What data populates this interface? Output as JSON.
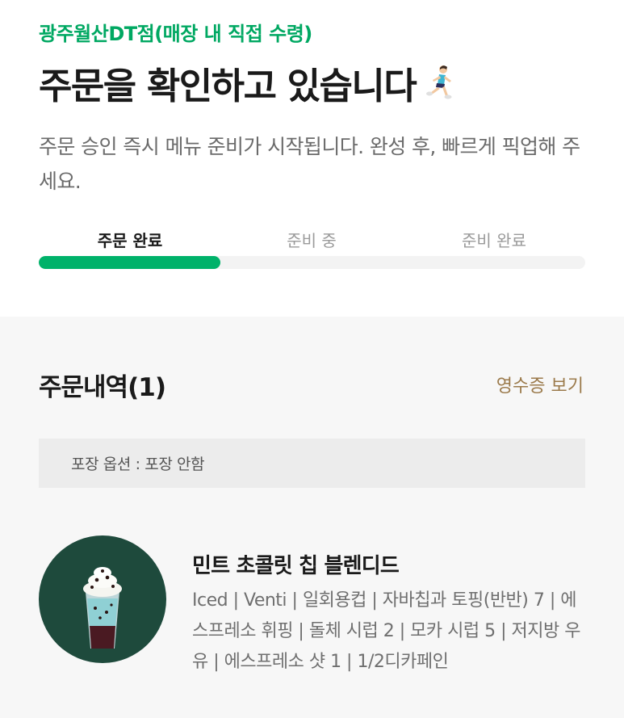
{
  "colors": {
    "brand_green": "#00a862",
    "progress_fill": "#00b26a",
    "receipt_brown": "#9b7a4b"
  },
  "header": {
    "store_name": "광주월산DT점(매장 내 직접 수령)",
    "headline": "주문을 확인하고 있습니다",
    "headline_icon": "running-woman-icon",
    "description": "주문 승인 즉시 메뉴 준비가 시작됩니다. 완성 후, 빠르게 픽업해 주세요."
  },
  "progress": {
    "steps": [
      {
        "label": "주문 완료",
        "active": true
      },
      {
        "label": "준비 중",
        "active": false
      },
      {
        "label": "준비 완료",
        "active": false
      }
    ],
    "fraction": 0.333
  },
  "order": {
    "title": "주문내역(1)",
    "receipt_link": "영수증 보기",
    "packaging": "포장 옵션 : 포장 안함",
    "items": [
      {
        "name": "민트 초콜릿 칩 블렌디드",
        "options": "Iced | Venti | 일회용컵 | 자바칩과 토핑(반반) 7 | 에스프레소 휘핑 | 돌체 시럽 2 | 모카 시럽 5 | 저지방 우유 | 에스프레소 샷 1 | 1/2디카페인",
        "image_icon": "frappuccino-drink-icon"
      }
    ]
  }
}
